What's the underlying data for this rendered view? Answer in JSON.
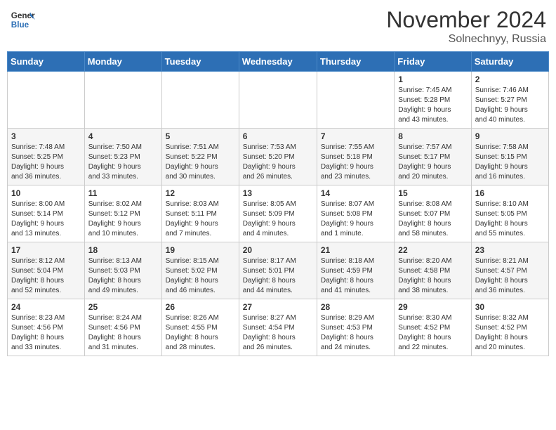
{
  "header": {
    "logo_line1": "General",
    "logo_line2": "Blue",
    "month": "November 2024",
    "location": "Solnechnyy, Russia"
  },
  "days_of_week": [
    "Sunday",
    "Monday",
    "Tuesday",
    "Wednesday",
    "Thursday",
    "Friday",
    "Saturday"
  ],
  "weeks": [
    [
      {
        "day": "",
        "info": ""
      },
      {
        "day": "",
        "info": ""
      },
      {
        "day": "",
        "info": ""
      },
      {
        "day": "",
        "info": ""
      },
      {
        "day": "",
        "info": ""
      },
      {
        "day": "1",
        "info": "Sunrise: 7:45 AM\nSunset: 5:28 PM\nDaylight: 9 hours\nand 43 minutes."
      },
      {
        "day": "2",
        "info": "Sunrise: 7:46 AM\nSunset: 5:27 PM\nDaylight: 9 hours\nand 40 minutes."
      }
    ],
    [
      {
        "day": "3",
        "info": "Sunrise: 7:48 AM\nSunset: 5:25 PM\nDaylight: 9 hours\nand 36 minutes."
      },
      {
        "day": "4",
        "info": "Sunrise: 7:50 AM\nSunset: 5:23 PM\nDaylight: 9 hours\nand 33 minutes."
      },
      {
        "day": "5",
        "info": "Sunrise: 7:51 AM\nSunset: 5:22 PM\nDaylight: 9 hours\nand 30 minutes."
      },
      {
        "day": "6",
        "info": "Sunrise: 7:53 AM\nSunset: 5:20 PM\nDaylight: 9 hours\nand 26 minutes."
      },
      {
        "day": "7",
        "info": "Sunrise: 7:55 AM\nSunset: 5:18 PM\nDaylight: 9 hours\nand 23 minutes."
      },
      {
        "day": "8",
        "info": "Sunrise: 7:57 AM\nSunset: 5:17 PM\nDaylight: 9 hours\nand 20 minutes."
      },
      {
        "day": "9",
        "info": "Sunrise: 7:58 AM\nSunset: 5:15 PM\nDaylight: 9 hours\nand 16 minutes."
      }
    ],
    [
      {
        "day": "10",
        "info": "Sunrise: 8:00 AM\nSunset: 5:14 PM\nDaylight: 9 hours\nand 13 minutes."
      },
      {
        "day": "11",
        "info": "Sunrise: 8:02 AM\nSunset: 5:12 PM\nDaylight: 9 hours\nand 10 minutes."
      },
      {
        "day": "12",
        "info": "Sunrise: 8:03 AM\nSunset: 5:11 PM\nDaylight: 9 hours\nand 7 minutes."
      },
      {
        "day": "13",
        "info": "Sunrise: 8:05 AM\nSunset: 5:09 PM\nDaylight: 9 hours\nand 4 minutes."
      },
      {
        "day": "14",
        "info": "Sunrise: 8:07 AM\nSunset: 5:08 PM\nDaylight: 9 hours\nand 1 minute."
      },
      {
        "day": "15",
        "info": "Sunrise: 8:08 AM\nSunset: 5:07 PM\nDaylight: 8 hours\nand 58 minutes."
      },
      {
        "day": "16",
        "info": "Sunrise: 8:10 AM\nSunset: 5:05 PM\nDaylight: 8 hours\nand 55 minutes."
      }
    ],
    [
      {
        "day": "17",
        "info": "Sunrise: 8:12 AM\nSunset: 5:04 PM\nDaylight: 8 hours\nand 52 minutes."
      },
      {
        "day": "18",
        "info": "Sunrise: 8:13 AM\nSunset: 5:03 PM\nDaylight: 8 hours\nand 49 minutes."
      },
      {
        "day": "19",
        "info": "Sunrise: 8:15 AM\nSunset: 5:02 PM\nDaylight: 8 hours\nand 46 minutes."
      },
      {
        "day": "20",
        "info": "Sunrise: 8:17 AM\nSunset: 5:01 PM\nDaylight: 8 hours\nand 44 minutes."
      },
      {
        "day": "21",
        "info": "Sunrise: 8:18 AM\nSunset: 4:59 PM\nDaylight: 8 hours\nand 41 minutes."
      },
      {
        "day": "22",
        "info": "Sunrise: 8:20 AM\nSunset: 4:58 PM\nDaylight: 8 hours\nand 38 minutes."
      },
      {
        "day": "23",
        "info": "Sunrise: 8:21 AM\nSunset: 4:57 PM\nDaylight: 8 hours\nand 36 minutes."
      }
    ],
    [
      {
        "day": "24",
        "info": "Sunrise: 8:23 AM\nSunset: 4:56 PM\nDaylight: 8 hours\nand 33 minutes."
      },
      {
        "day": "25",
        "info": "Sunrise: 8:24 AM\nSunset: 4:56 PM\nDaylight: 8 hours\nand 31 minutes."
      },
      {
        "day": "26",
        "info": "Sunrise: 8:26 AM\nSunset: 4:55 PM\nDaylight: 8 hours\nand 28 minutes."
      },
      {
        "day": "27",
        "info": "Sunrise: 8:27 AM\nSunset: 4:54 PM\nDaylight: 8 hours\nand 26 minutes."
      },
      {
        "day": "28",
        "info": "Sunrise: 8:29 AM\nSunset: 4:53 PM\nDaylight: 8 hours\nand 24 minutes."
      },
      {
        "day": "29",
        "info": "Sunrise: 8:30 AM\nSunset: 4:52 PM\nDaylight: 8 hours\nand 22 minutes."
      },
      {
        "day": "30",
        "info": "Sunrise: 8:32 AM\nSunset: 4:52 PM\nDaylight: 8 hours\nand 20 minutes."
      }
    ]
  ]
}
